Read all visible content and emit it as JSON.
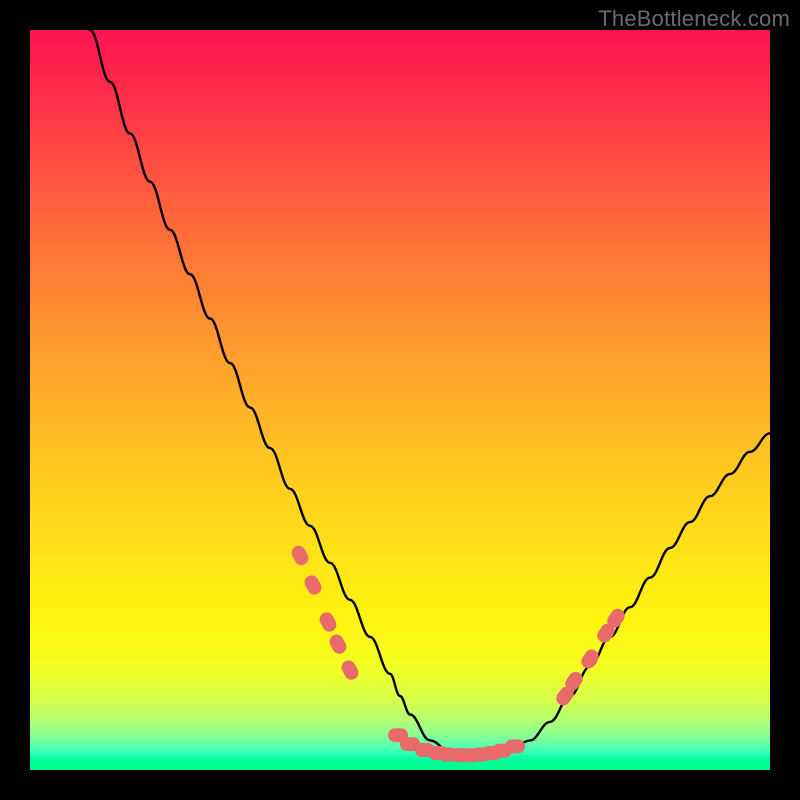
{
  "watermark": "TheBottleneck.com",
  "colors": {
    "frame": "#000000",
    "gradient_top": "#ff1452",
    "gradient_mid": "#ffe118",
    "gradient_bottom": "#00ff85",
    "curve_stroke": "#000000",
    "marker_fill": "#e86a6a"
  },
  "chart_data": {
    "type": "line",
    "title": "",
    "xlabel": "",
    "ylabel": "",
    "xlim": [
      0,
      740
    ],
    "ylim": [
      0,
      100
    ],
    "annotations": [],
    "series": [
      {
        "name": "bottleneck-curve",
        "x": [
          60,
          80,
          100,
          120,
          140,
          160,
          180,
          200,
          220,
          240,
          260,
          280,
          300,
          320,
          340,
          360,
          370,
          380,
          400,
          420,
          440,
          460,
          480,
          500,
          520,
          540,
          560,
          580,
          600,
          620,
          640,
          660,
          680,
          700,
          720,
          740
        ],
        "y": [
          100,
          93,
          86,
          79.5,
          73,
          67,
          61,
          55,
          49,
          43.5,
          38,
          33,
          28,
          23,
          18,
          13,
          10,
          7.5,
          4,
          2.5,
          2,
          2,
          2.6,
          4,
          6.5,
          10,
          14,
          18,
          22,
          26,
          30,
          33.5,
          37,
          40,
          43,
          45.5
        ]
      }
    ],
    "markers": {
      "name": "highlighted-points",
      "left_cluster": [
        {
          "x": 270,
          "y": 29
        },
        {
          "x": 283,
          "y": 25
        },
        {
          "x": 298,
          "y": 20
        },
        {
          "x": 308,
          "y": 17
        },
        {
          "x": 320,
          "y": 13.5
        }
      ],
      "bottom_cluster": [
        {
          "x": 368,
          "y": 4.7
        },
        {
          "x": 380,
          "y": 3.5
        },
        {
          "x": 395,
          "y": 2.7
        },
        {
          "x": 408,
          "y": 2.3
        },
        {
          "x": 418,
          "y": 2.1
        },
        {
          "x": 430,
          "y": 2.0
        },
        {
          "x": 440,
          "y": 2.0
        },
        {
          "x": 451,
          "y": 2.1
        },
        {
          "x": 462,
          "y": 2.3
        },
        {
          "x": 472,
          "y": 2.6
        },
        {
          "x": 485,
          "y": 3.2
        }
      ],
      "right_cluster": [
        {
          "x": 535,
          "y": 10
        },
        {
          "x": 544,
          "y": 12
        },
        {
          "x": 560,
          "y": 15
        },
        {
          "x": 576,
          "y": 18.5
        },
        {
          "x": 586,
          "y": 20.5
        }
      ]
    }
  }
}
